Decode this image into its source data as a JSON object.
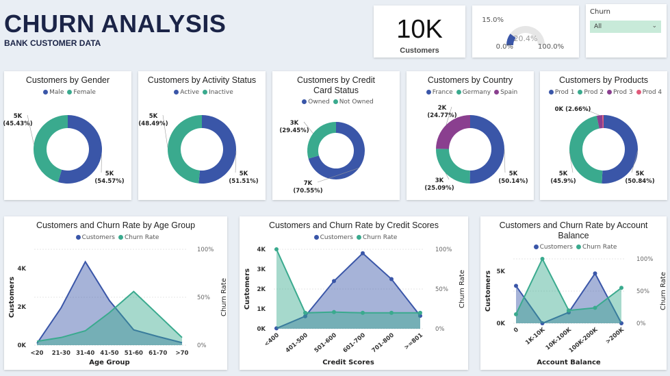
{
  "header": {
    "title": "CHURN ANALYSIS",
    "subtitle": "BANK CUSTOMER DATA"
  },
  "kpi": {
    "value": "10K",
    "label": "Customers"
  },
  "gauge": {
    "value": 20.4,
    "value_label": "20.4%",
    "target_label": "15.0%",
    "min_label": "0.0%",
    "max_label": "100.0%",
    "fill_color": "#3a56a8",
    "track_color": "#e6e6e6"
  },
  "filter": {
    "label": "Churn",
    "selected": "All"
  },
  "colors": {
    "blue": "#3a56a8",
    "teal": "#3aaa8e",
    "purple": "#8a3f8f",
    "pink": "#e05a7a"
  },
  "chart_data": [
    {
      "type": "pie",
      "title": "Customers by Gender",
      "legend": [
        "Male",
        "Female"
      ],
      "slices": [
        {
          "name": "Male",
          "value": 54.57,
          "label1": "5K",
          "label2": "(54.57%)"
        },
        {
          "name": "Female",
          "value": 45.43,
          "label1": "5K",
          "label2": "(45.43%)"
        }
      ]
    },
    {
      "type": "pie",
      "title": "Customers by Activity Status",
      "legend": [
        "Active",
        "Inactive"
      ],
      "slices": [
        {
          "name": "Active",
          "value": 51.51,
          "label1": "5K",
          "label2": "(51.51%)"
        },
        {
          "name": "Inactive",
          "value": 48.49,
          "label1": "5K",
          "label2": "(48.49%)"
        }
      ]
    },
    {
      "type": "pie",
      "title": "Customers by Credit Card Status",
      "legend": [
        "Owned",
        "Not Owned"
      ],
      "slices": [
        {
          "name": "Owned",
          "value": 70.55,
          "label1": "7K",
          "label2": "(70.55%)"
        },
        {
          "name": "Not Owned",
          "value": 29.45,
          "label1": "3K",
          "label2": "(29.45%)"
        }
      ]
    },
    {
      "type": "pie",
      "title": "Customers by Country",
      "legend": [
        "France",
        "Germany",
        "Spain"
      ],
      "slices": [
        {
          "name": "France",
          "value": 50.14,
          "label1": "5K",
          "label2": "(50.14%)"
        },
        {
          "name": "Germany",
          "value": 25.09,
          "label1": "3K",
          "label2": "(25.09%)"
        },
        {
          "name": "Spain",
          "value": 24.77,
          "label1": "2K",
          "label2": "(24.77%)"
        }
      ]
    },
    {
      "type": "pie",
      "title": "Customers by Products",
      "legend": [
        "Prod 1",
        "Prod 2",
        "Prod 3",
        "Prod 4"
      ],
      "slices": [
        {
          "name": "Prod 1",
          "value": 50.84,
          "label1": "5K",
          "label2": "(50.84%)"
        },
        {
          "name": "Prod 2",
          "value": 45.9,
          "label1": "5K",
          "label2": "(45.9%)"
        },
        {
          "name": "Prod 3",
          "value": 2.66,
          "label1": "0K (2.66%)",
          "label2": ""
        },
        {
          "name": "Prod 4",
          "value": 0.6,
          "label1": "",
          "label2": ""
        }
      ]
    },
    {
      "type": "area",
      "title": "Customers and Churn Rate by Age Group",
      "categories": [
        "<20",
        "21-30",
        "31-40",
        "41-50",
        "51-60",
        "61-70",
        ">70"
      ],
      "series": [
        {
          "name": "Customers",
          "axis": "left",
          "values": [
            90,
            1950,
            4350,
            2320,
            800,
            450,
            130
          ]
        },
        {
          "name": "Churn Rate",
          "axis": "right",
          "values": [
            4,
            8,
            15,
            34,
            56,
            32,
            8
          ]
        }
      ],
      "xlabel": "Age Group",
      "ylabel": "Customers",
      "y2label": "Churn Rate",
      "yticks": [
        "0K",
        "2K",
        "4K"
      ],
      "ylim": [
        0,
        5000
      ],
      "y2ticks": [
        "0%",
        "50%",
        "100%"
      ],
      "y2lim": [
        0,
        100
      ],
      "markers": false
    },
    {
      "type": "area",
      "title": "Customers and Churn Rate by Credit Scores",
      "categories": [
        "<400",
        "401-500",
        "501-600",
        "601-700",
        "701-800",
        ">=801"
      ],
      "series": [
        {
          "name": "Customers",
          "axis": "left",
          "values": [
            20,
            630,
            2400,
            3800,
            2500,
            650
          ]
        },
        {
          "name": "Churn Rate",
          "axis": "right",
          "values": [
            100,
            20,
            21,
            20,
            20,
            20
          ]
        }
      ],
      "xlabel": "Credit Scores",
      "ylabel": "Customers",
      "y2label": "Churn Rate",
      "yticks": [
        "0K",
        "1K",
        "2K",
        "3K",
        "4K"
      ],
      "ylim": [
        0,
        4000
      ],
      "y2ticks": [
        "0%",
        "50%",
        "100%"
      ],
      "y2lim": [
        0,
        100
      ],
      "markers": true
    },
    {
      "type": "area",
      "title": "Customers and Churn Rate by Account Balance",
      "categories": [
        "0",
        "1K-10K",
        "10K-100K",
        "100K-200K",
        ">200K"
      ],
      "series": [
        {
          "name": "Customers",
          "axis": "left",
          "values": [
            3600,
            0,
            1050,
            4800,
            0
          ]
        },
        {
          "name": "Churn Rate",
          "axis": "right",
          "values": [
            14,
            100,
            20,
            24,
            55
          ]
        }
      ],
      "xlabel": "Account Balance",
      "ylabel": "Customers",
      "y2label": "Churn Rate",
      "yticks": [
        "0K",
        "5K"
      ],
      "ylim": [
        0,
        6200
      ],
      "y2ticks": [
        "0%",
        "50%",
        "100%"
      ],
      "y2lim": [
        0,
        100
      ],
      "markers": true
    }
  ]
}
